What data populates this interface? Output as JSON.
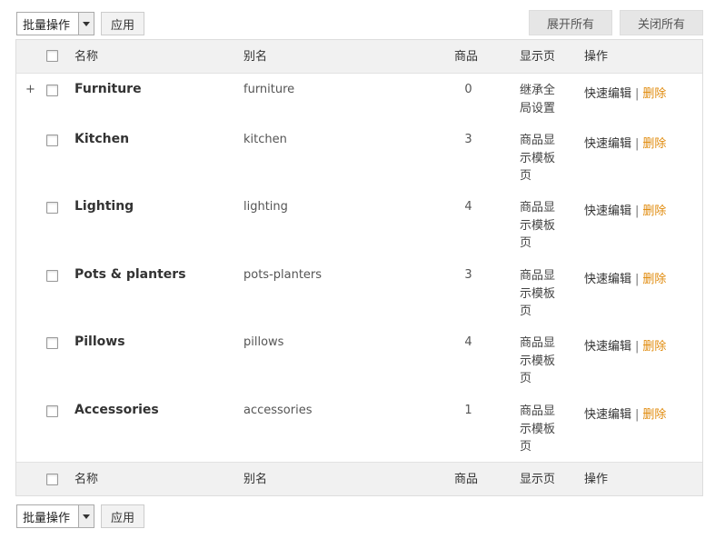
{
  "bulk_top": {
    "select_value": "批量操作",
    "apply_label": "应用"
  },
  "bulk_bottom": {
    "select_value": "批量操作",
    "apply_label": "应用"
  },
  "toolbar": {
    "expand_all": "展开所有",
    "collapse_all": "关闭所有"
  },
  "columns": {
    "name": "名称",
    "slug": "别名",
    "count": "商品",
    "display": "显示页",
    "actions": "操作"
  },
  "row_actions": {
    "edit": "快速编辑",
    "separator": "|",
    "delete": "删除"
  },
  "colors": {
    "delete_link": "#e08a0b",
    "header_bg": "#f1f1f1"
  },
  "rows": [
    {
      "toggle": "+",
      "name": "Furniture",
      "slug": "furniture",
      "count": "0",
      "display": "继承全局设置"
    },
    {
      "toggle": "",
      "name": "Kitchen",
      "slug": "kitchen",
      "count": "3",
      "display": "商品显示模板页"
    },
    {
      "toggle": "",
      "name": "Lighting",
      "slug": "lighting",
      "count": "4",
      "display": "商品显示模板页"
    },
    {
      "toggle": "",
      "name": "Pots & planters",
      "slug": "pots-planters",
      "count": "3",
      "display": "商品显示模板页"
    },
    {
      "toggle": "",
      "name": "Pillows",
      "slug": "pillows",
      "count": "4",
      "display": "商品显示模板页"
    },
    {
      "toggle": "",
      "name": "Accessories",
      "slug": "accessories",
      "count": "1",
      "display": "商品显示模板页"
    }
  ]
}
